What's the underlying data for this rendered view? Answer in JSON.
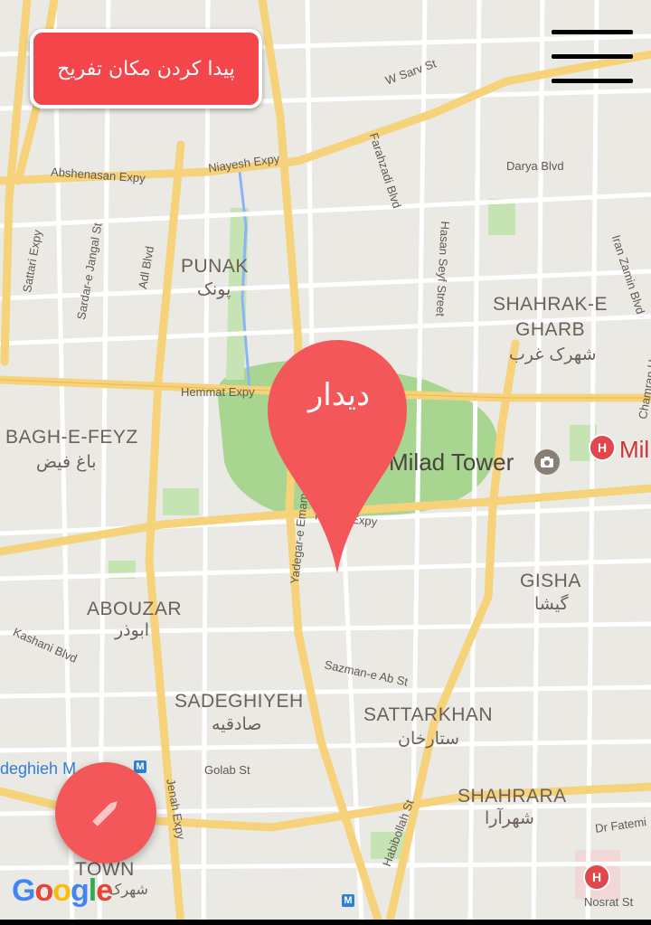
{
  "header": {
    "find_button_label": "پیدا کردن مکان تفریح",
    "menu_icon": "hamburger-menu-icon"
  },
  "marker": {
    "label": "دیدار",
    "color": "#f4575a",
    "icon": "map-pin-icon"
  },
  "fab": {
    "icon": "pencil-icon",
    "color": "#f4575a"
  },
  "attribution": {
    "logo_letters": [
      "G",
      "o",
      "o",
      "g",
      "l",
      "e"
    ],
    "logo_colors": [
      "#4285f4",
      "#ea4335",
      "#fbbc05",
      "#4285f4",
      "#34a853",
      "#ea4335"
    ]
  },
  "map": {
    "districts": [
      {
        "en": "PUNAK",
        "fa": "پونک"
      },
      {
        "en": "BAGH-E-FEYZ",
        "fa": "باغ فیض"
      },
      {
        "en": "SHAHRAK-E",
        "en2": "GHARB",
        "fa": "شهرک غرب"
      },
      {
        "en": "ABOUZAR",
        "fa": "ابوذر"
      },
      {
        "en": "GISHA",
        "fa": "گیشا"
      },
      {
        "en": "SADEGHIYEH",
        "fa": "صادقیه"
      },
      {
        "en": "SATTARKHAN",
        "fa": "ستارخان"
      },
      {
        "en": "SHAHRARA",
        "fa": "شهرآرا"
      },
      {
        "en": "TOWN",
        "fa": "شهرک"
      }
    ],
    "landmark": {
      "name": "Milad Tower",
      "icon": "camera-icon"
    },
    "hospital_label": "Mil",
    "streets": {
      "w_sarv": "W Sarv St",
      "niayesh": "Niayesh Expy",
      "absenasan": "Abshenasan Expy",
      "darya": "Darya Blvd",
      "farahzadi": "Farahzadi Blvd",
      "hasan_seyf": "Hasan Seyf Street",
      "iran_zamin": "Iran Zamin Blvd",
      "chamran": "Chamran Hwy",
      "sattari": "Sattari Expy",
      "sardar": "Sardar-e Jangal St",
      "adl": "Adl Blvd",
      "hemmat": "Hemmat Expy",
      "yadegar": "Yadegar-e Emam Hwy",
      "hakim": "Hakim Expy",
      "kashani": "Kashani Blvd",
      "sazman": "Sazman-e Ab St",
      "golab": "Golab St",
      "jenah": "Jenah Expy",
      "habibollah": "Habibollah St",
      "fatemi": "Dr Fatemi",
      "nosrat": "Nosrat St",
      "sadeghieh_metro": "deghieh M"
    },
    "metro_icon": "metro-icon",
    "hospital_icon": "hospital-icon"
  }
}
